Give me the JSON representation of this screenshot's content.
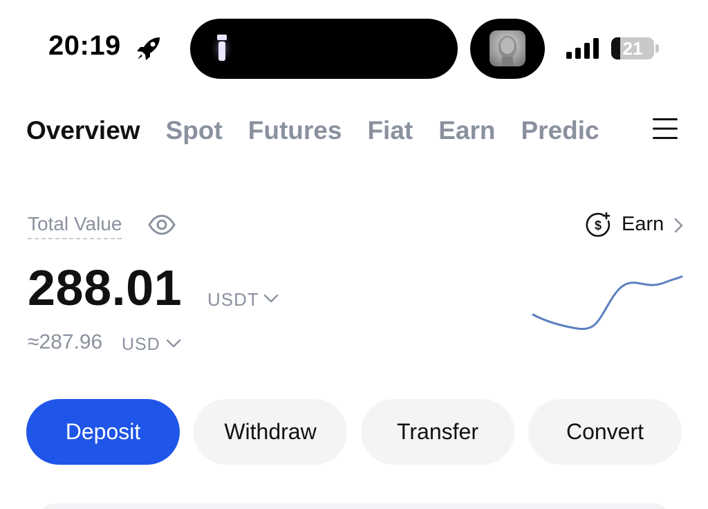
{
  "status_bar": {
    "time": "20:19",
    "battery_level": "21",
    "battery_fraction": 0.21,
    "icons": [
      "rocket-icon",
      "flashlight-icon",
      "avatar",
      "signal-icon",
      "battery-icon"
    ]
  },
  "tabs": [
    {
      "label": "Overview",
      "active": true
    },
    {
      "label": "Spot",
      "active": false
    },
    {
      "label": "Futures",
      "active": false
    },
    {
      "label": "Fiat",
      "active": false
    },
    {
      "label": "Earn",
      "active": false
    },
    {
      "label": "Predic",
      "active": false
    }
  ],
  "menu_icon": "menu-icon",
  "overview": {
    "total_label": "Total Value",
    "earn_link_label": "Earn",
    "balance": "288.01",
    "balance_unit": "USDT",
    "approx_value": "≈287.96",
    "approx_unit": "USD"
  },
  "actions": {
    "deposit": "Deposit",
    "withdraw": "Withdraw",
    "transfer": "Transfer",
    "convert": "Convert"
  },
  "colors": {
    "primary": "#1f55e8",
    "muted_text": "#8a919e",
    "button_bg": "#f3f4f6",
    "sparkline": "#5b7fbf"
  }
}
